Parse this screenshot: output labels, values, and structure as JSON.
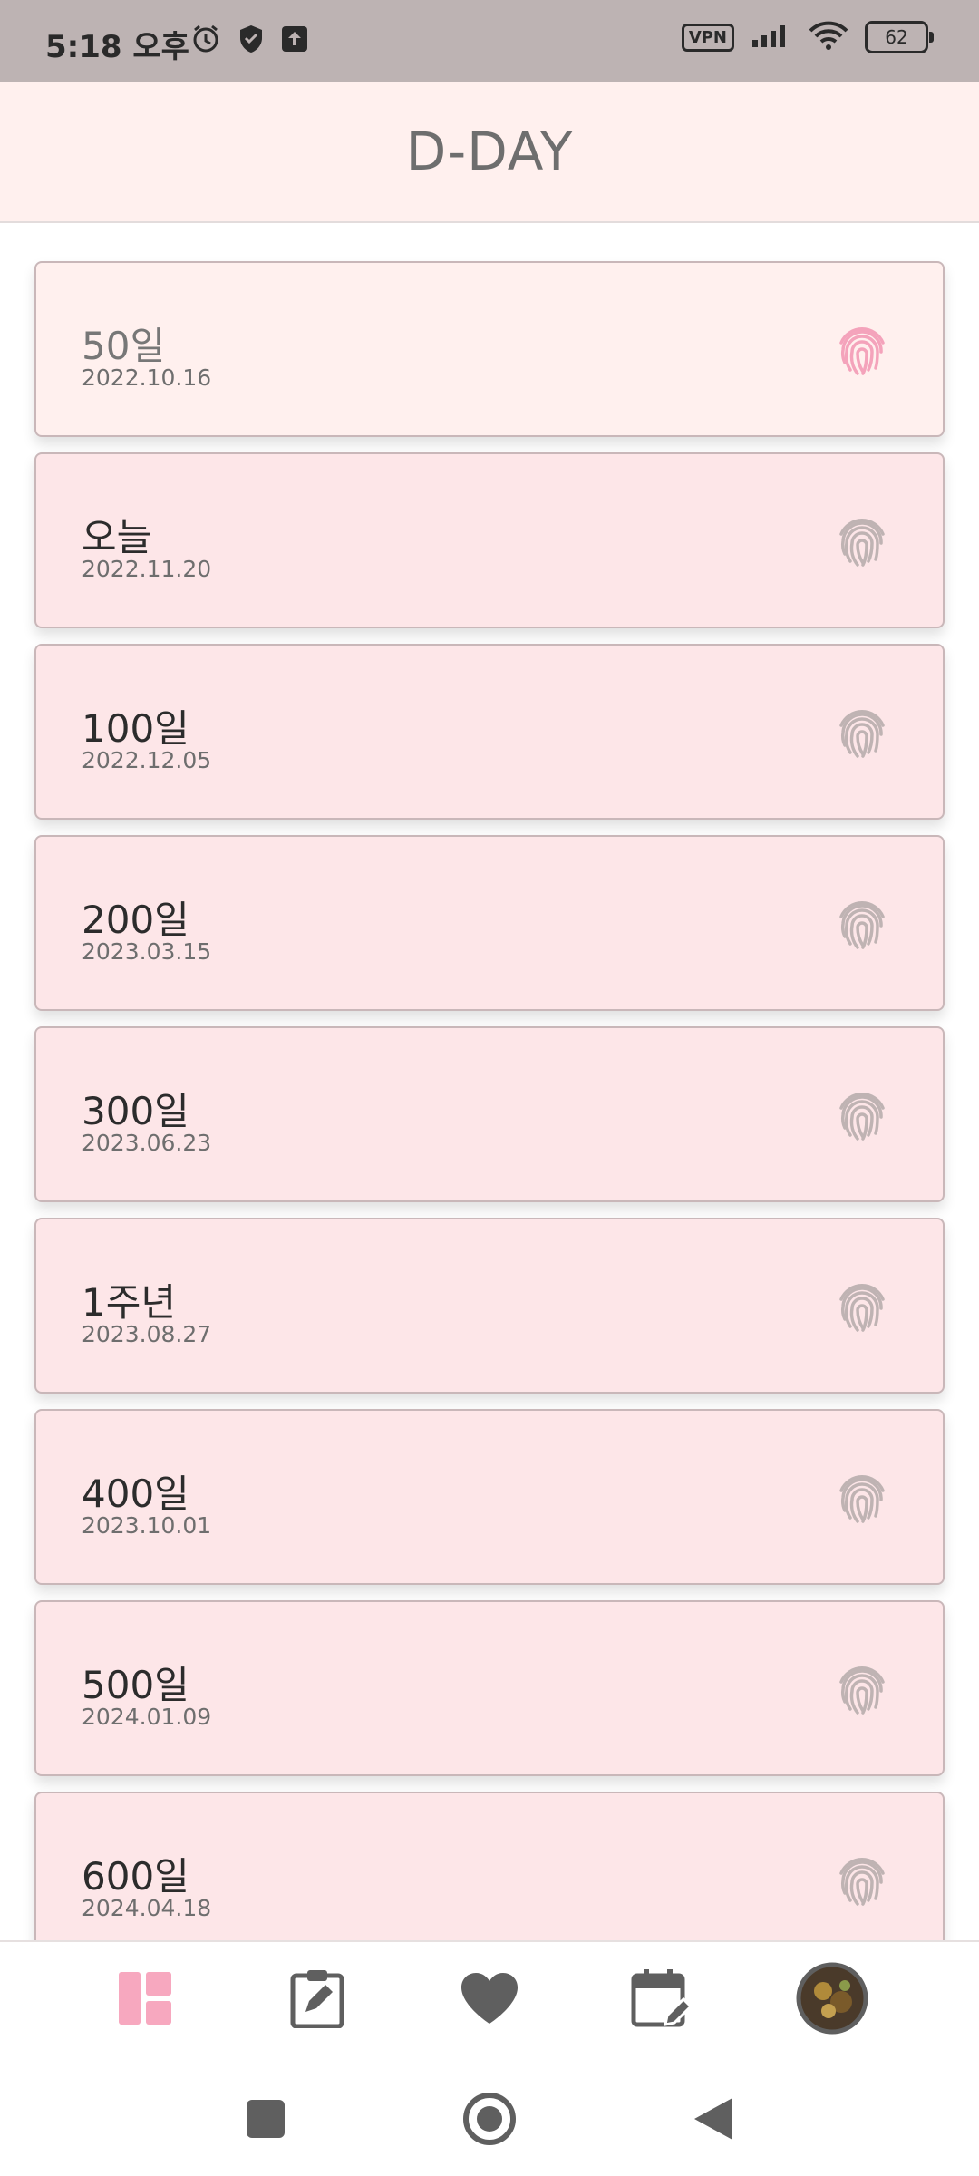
{
  "status_bar": {
    "time": "5:18 오후",
    "vpn_label": "VPN",
    "battery": "62",
    "icons": [
      "alarm-icon",
      "shield-icon",
      "upload-icon",
      "signal-icon",
      "wifi-icon",
      "battery-icon"
    ]
  },
  "header": {
    "title": "D-DAY"
  },
  "dday_list": [
    {
      "title": "50일",
      "date": "2022.10.16",
      "highlight": true
    },
    {
      "title": "오늘",
      "date": "2022.11.20",
      "highlight": false
    },
    {
      "title": "100일",
      "date": "2022.12.05",
      "highlight": false
    },
    {
      "title": "200일",
      "date": "2023.03.15",
      "highlight": false
    },
    {
      "title": "300일",
      "date": "2023.06.23",
      "highlight": false
    },
    {
      "title": "1주년",
      "date": "2023.08.27",
      "highlight": false
    },
    {
      "title": "400일",
      "date": "2023.10.01",
      "highlight": false
    },
    {
      "title": "500일",
      "date": "2024.01.09",
      "highlight": false
    },
    {
      "title": "600일",
      "date": "2024.04.18",
      "highlight": false
    }
  ],
  "bottom_nav": {
    "items": [
      "dashboard-icon",
      "edit-clipboard-icon",
      "heart-icon",
      "calendar-edit-icon",
      "profile-avatar"
    ],
    "active_index": 0,
    "active_color": "#f7a8bf",
    "inactive_color": "#5f5f5f"
  },
  "colors": {
    "header_bg": "#fff0ee",
    "card_bg": "#fde6e8",
    "fingerprint_active": "#f4a3bb",
    "fingerprint_inactive": "#bfb3b3"
  }
}
